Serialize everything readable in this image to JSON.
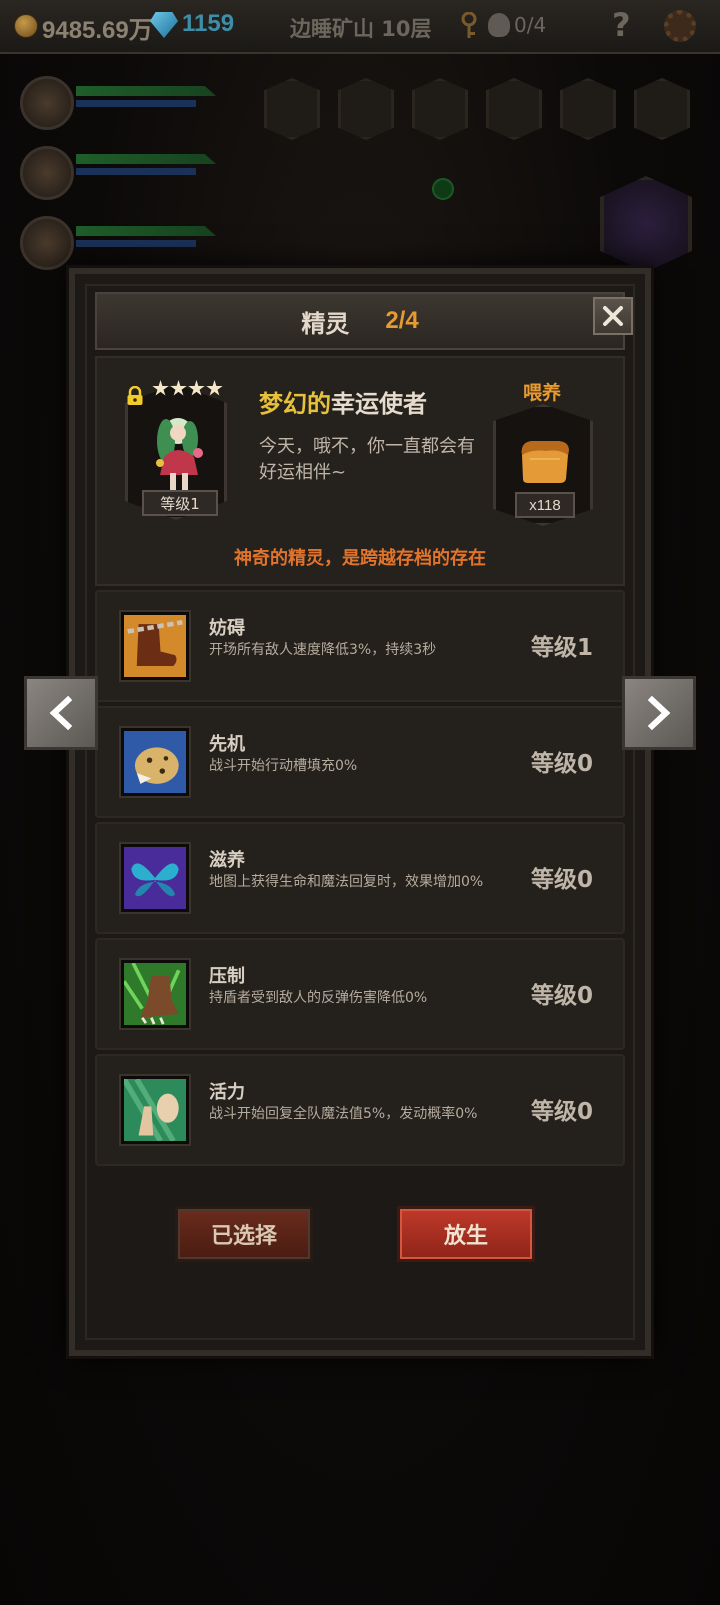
{
  "topbar": {
    "gold": "9485.69万",
    "gems": "1159",
    "location": "边睡矿山 10层",
    "skull_count": "0/4",
    "help_label": "?"
  },
  "dialog": {
    "title": "精灵",
    "count": "2/4",
    "pet": {
      "name_prefix": "梦幻的",
      "name_rest": "幸运使者",
      "description": "今天，哦不，你一直都会有好运相伴~",
      "level": "等级1",
      "stars": 4,
      "locked": true
    },
    "feed": {
      "label": "喂养",
      "count": "x118"
    },
    "tagline": "神奇的精灵，是跨越存档的存在",
    "skills": [
      {
        "name": "妨碍",
        "desc": "开场所有敌人速度降低3%，持续3秒",
        "level": "等级1"
      },
      {
        "name": "先机",
        "desc": "战斗开始行动槽填充0%",
        "level": "等级0"
      },
      {
        "name": "滋养",
        "desc": "地图上获得生命和魔法回复时，效果增加0%",
        "level": "等级0"
      },
      {
        "name": "压制",
        "desc": "持盾者受到敌人的反弹伤害降低0%",
        "level": "等级0"
      },
      {
        "name": "活力",
        "desc": "战斗开始回复全队魔法值5%，发动概率0%",
        "level": "等级0"
      }
    ],
    "buttons": {
      "selected": "已选择",
      "release": "放生"
    }
  },
  "colors": {
    "accent_orange": "#e69a2f",
    "tagline": "#e0742c",
    "name_gold": "#e8c13a",
    "release_red": "#c0392b"
  }
}
